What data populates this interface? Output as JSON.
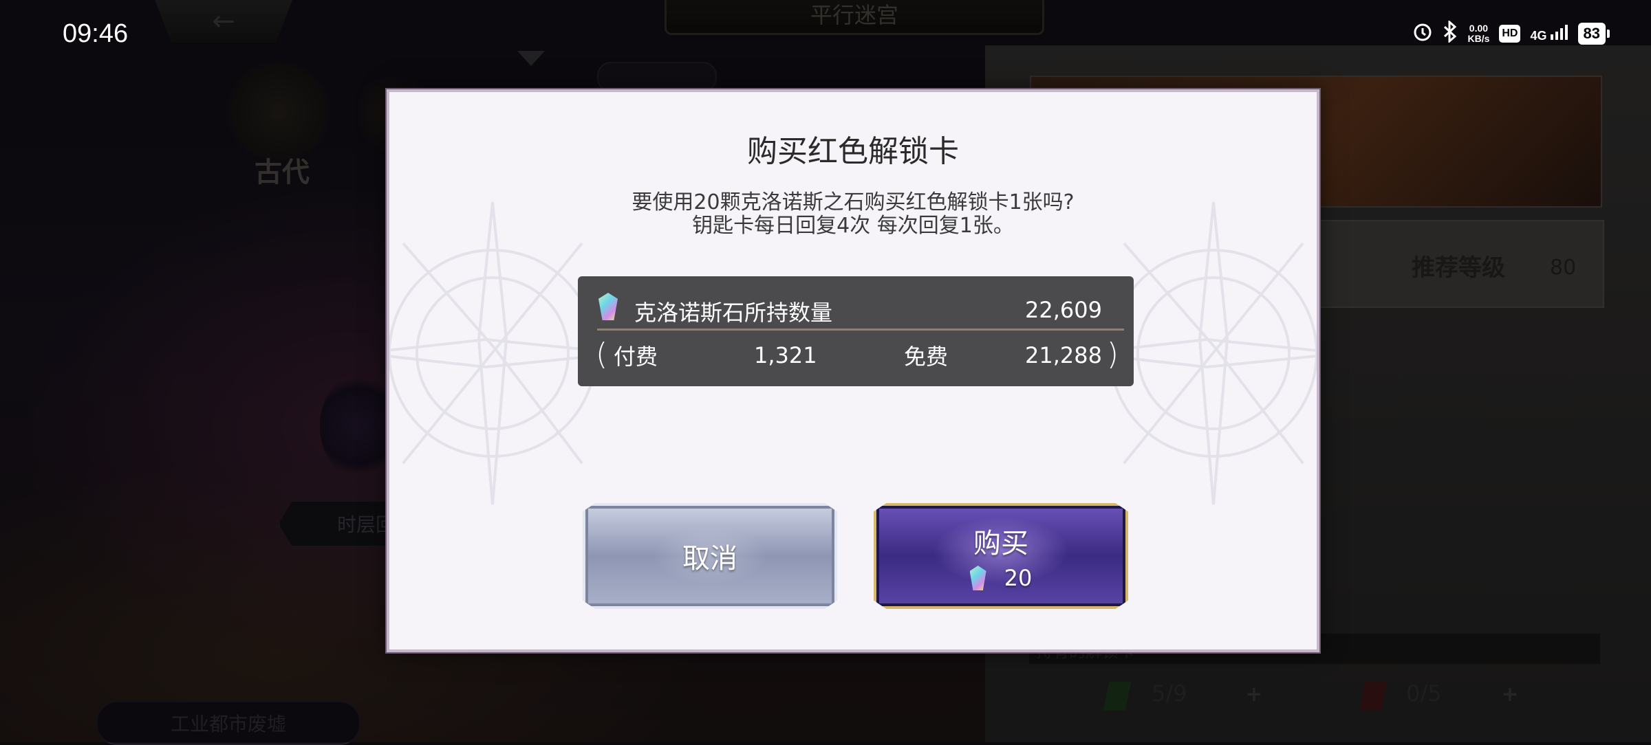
{
  "status_bar": {
    "time": "09:46",
    "net_speed_value": "0.00",
    "net_speed_unit": "KB/s",
    "hd_badge": "HD",
    "network": "4G",
    "battery": "83"
  },
  "background": {
    "screen_title": "平行迷宫",
    "back_arrow": "←",
    "era_label": "古代",
    "floor_tag": "时层回",
    "area_tag": "工业都市废墟",
    "recommend_level_label": "推荐等级",
    "recommend_level_value": "80",
    "keys_header": "持有的解锁卡",
    "green_keys": "5/9",
    "red_keys": "0/5",
    "plus": "+"
  },
  "dialog": {
    "title": "购买红色解锁卡",
    "message_line1": "要使用20颗克洛诺斯之石购买红色解锁卡1张吗?",
    "message_line2": "钥匙卡每日回复4次 每次回复1张。",
    "currency": {
      "label": "克洛诺斯石所持数量",
      "total": "22,609",
      "paren_open": "(",
      "paren_close": ")",
      "paid_label": "付费",
      "paid_value": "1,321",
      "free_label": "免费",
      "free_value": "21,288",
      "icon": "chronos-stone-icon"
    },
    "cancel_label": "取消",
    "buy_label": "购买",
    "buy_cost": "20"
  }
}
